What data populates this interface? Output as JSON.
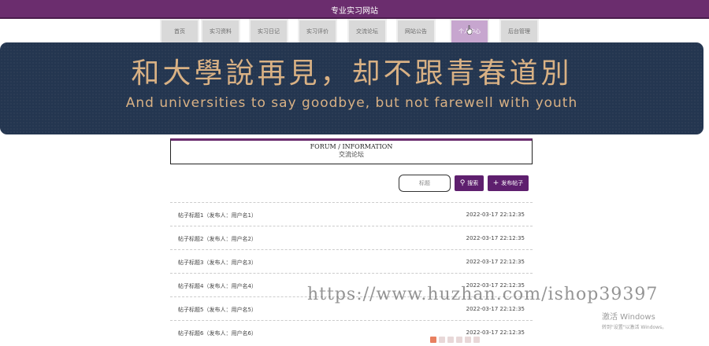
{
  "header": {
    "title": "专业实习网站"
  },
  "nav": {
    "items": [
      {
        "label": "首页"
      },
      {
        "label": "实习资料"
      },
      {
        "label": "实习日记"
      },
      {
        "label": "实习评价"
      },
      {
        "label": "交流论坛"
      },
      {
        "label": "网站公告"
      },
      {
        "label": "个人中心"
      },
      {
        "label": "后台管理"
      }
    ],
    "active_index": 6
  },
  "banner": {
    "cn": "和大學說再見，却不跟青春道別",
    "en": "And universities to say goodbye, but not farewell with youth"
  },
  "section": {
    "en": "FORUM / INFORMATION",
    "cn": "交流论坛"
  },
  "search": {
    "placeholder": "标题",
    "search_label": "搜索",
    "publish_label": "发布帖子"
  },
  "posts": [
    {
      "title": "帖子标题1（发布人：用户名1）",
      "date": "2022-03-17 22:12:35"
    },
    {
      "title": "帖子标题2（发布人：用户名2）",
      "date": "2022-03-17 22:12:35"
    },
    {
      "title": "帖子标题3（发布人：用户名3）",
      "date": "2022-03-17 22:12:35"
    },
    {
      "title": "帖子标题4（发布人：用户名4）",
      "date": "2022-03-17 22:12:35"
    },
    {
      "title": "帖子标题5（发布人：用户名5）",
      "date": "2022-03-17 22:12:35"
    },
    {
      "title": "帖子标题6（发布人：用户名6）",
      "date": "2022-03-17 22:12:35"
    }
  ],
  "overlay": {
    "watermark": "https://www.huzhan.com/ishop39397",
    "activate_title": "激活 Windows",
    "activate_sub": "转到\"设置\"以激活 Windows。"
  },
  "colors": {
    "accent": "#6b2d6e",
    "banner_bg": "#243650",
    "banner_text": "#d9b184"
  }
}
